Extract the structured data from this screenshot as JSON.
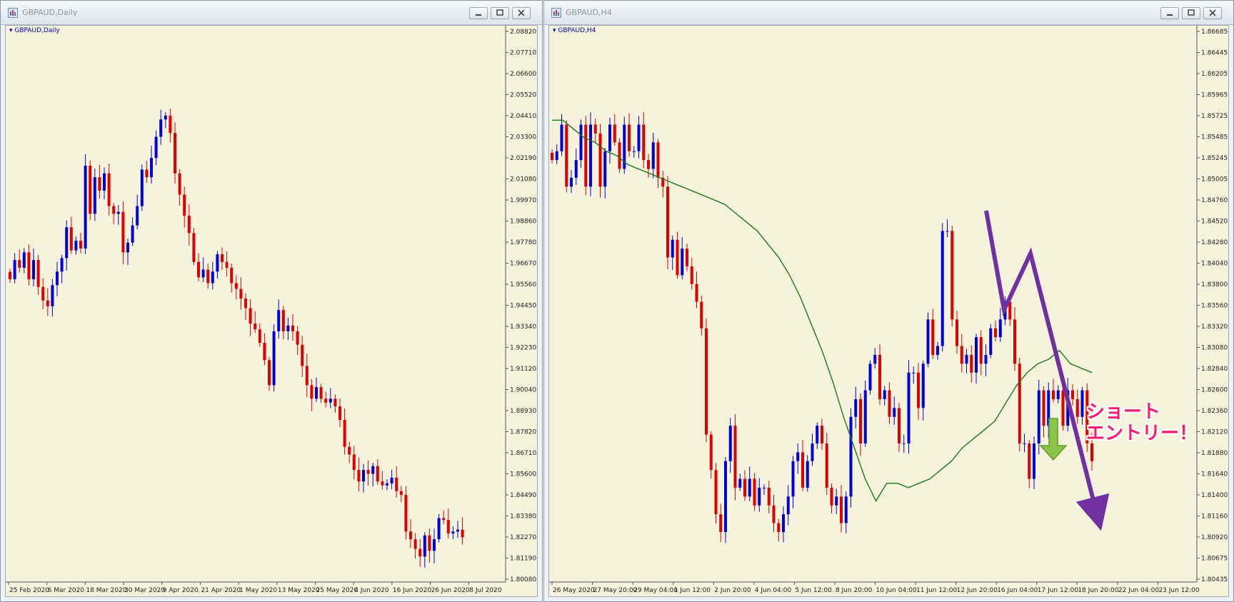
{
  "windows": [
    {
      "title": "GBPAUD,Daily",
      "symbol_label": "GBPAUD,Daily",
      "controls": [
        "minimize-icon",
        "restore-icon",
        "close-icon"
      ],
      "chart_data": {
        "type": "candlestick",
        "symbol": "GBPAUD",
        "timeframe": "Daily",
        "price_ticks": [
          "2.08820",
          "2.07710",
          "2.06600",
          "2.05520",
          "2.04410",
          "2.03300",
          "2.02190",
          "2.01080",
          "1.99970",
          "1.98860",
          "1.97780",
          "1.96670",
          "1.95560",
          "1.94450",
          "1.93340",
          "1.92230",
          "1.91120",
          "1.90040",
          "1.88930",
          "1.87820",
          "1.86710",
          "1.85600",
          "1.84490",
          "1.83380",
          "1.82270",
          "1.81190",
          "1.80080"
        ],
        "ylim": [
          1.8008,
          2.0882
        ],
        "time_ticks": [
          "25 Feb 2020",
          "6 Mar 2020",
          "18 Mar 2020",
          "30 Mar 2020",
          "9 Apr 2020",
          "21 Apr 2020",
          "1 May 2020",
          "13 May 2020",
          "25 May 2020",
          "4 Jun 2020",
          "16 Jun 2020",
          "26 Jun 2020",
          "8 Jul 2020"
        ],
        "up_color": "#0000dd",
        "down_color": "#e00000",
        "grid": false,
        "close": [
          1.958,
          1.968,
          1.964,
          1.972,
          1.958,
          1.968,
          1.954,
          1.947,
          1.944,
          1.955,
          1.962,
          1.969,
          1.985,
          1.973,
          1.978,
          1.974,
          2.017,
          1.992,
          2.011,
          2.004,
          2.013,
          1.996,
          1.992,
          1.993,
          1.972,
          1.977,
          1.986,
          1.996,
          2.015,
          2.011,
          2.021,
          2.032,
          2.041,
          2.043,
          2.034,
          2.013,
          2.002,
          1.991,
          1.982,
          1.967,
          1.959,
          1.963,
          1.956,
          1.962,
          1.971,
          1.967,
          1.964,
          1.956,
          1.953,
          1.948,
          1.943,
          1.935,
          1.932,
          1.925,
          1.916,
          1.903,
          1.931,
          1.942,
          1.931,
          1.934,
          1.931,
          1.924,
          1.913,
          1.903,
          1.896,
          1.902,
          1.896,
          1.894,
          1.896,
          1.892,
          1.885,
          1.871,
          1.867,
          1.859,
          1.853,
          1.859,
          1.857,
          1.861,
          1.853,
          1.851,
          1.852,
          1.855,
          1.848,
          1.846,
          1.827,
          1.823,
          1.818,
          1.814,
          1.825,
          1.817,
          1.823,
          1.834,
          1.833,
          1.826,
          1.827,
          1.828,
          1.824
        ]
      }
    },
    {
      "title": "GBPAUD,H4",
      "symbol_label": "GBPAUD,H4",
      "controls": [
        "minimize-icon",
        "restore-icon",
        "close-icon"
      ],
      "chart_data": {
        "type": "candlestick",
        "symbol": "GBPAUD",
        "timeframe": "H4",
        "price_ticks": [
          "1.86685",
          "1.86445",
          "1.86205",
          "1.85965",
          "1.85725",
          "1.85485",
          "1.85245",
          "1.85005",
          "1.84760",
          "1.84520",
          "1.84280",
          "1.84040",
          "1.83800",
          "1.83560",
          "1.83320",
          "1.83080",
          "1.82840",
          "1.82600",
          "1.82360",
          "1.82120",
          "1.81880",
          "1.81640",
          "1.81400",
          "1.81160",
          "1.80920",
          "1.80675",
          "1.80435"
        ],
        "ylim": [
          1.80435,
          1.86685
        ],
        "time_ticks": [
          "26 May 2020",
          "27 May 20:00",
          "29 May 04:00",
          "1 Jun 12:00",
          "2 Jun 20:00",
          "4 Jun 04:00",
          "5 Jun 12:00",
          "8 Jun 20:00",
          "10 Jun 04:00",
          "11 Jun 12:00",
          "12 Jun 20:00",
          "16 Jun 04:00",
          "17 Jun 12:00",
          "18 Jun 20:00",
          "22 Jun 04:00",
          "23 Jun 12:00"
        ],
        "up_color": "#0000dd",
        "down_color": "#e00000",
        "ma_color": "#1a7a1a",
        "arrow_color": "#7030a0",
        "grid": false,
        "close": [
          1.852,
          1.853,
          1.856,
          1.849,
          1.85,
          1.852,
          1.856,
          1.849,
          1.856,
          1.855,
          1.849,
          1.853,
          1.856,
          1.854,
          1.851,
          1.856,
          1.853,
          1.853,
          1.856,
          1.852,
          1.851,
          1.854,
          1.85,
          1.849,
          1.841,
          1.843,
          1.839,
          1.842,
          1.84,
          1.838,
          1.836,
          1.833,
          1.821,
          1.817,
          1.812,
          1.81,
          1.818,
          1.822,
          1.815,
          1.816,
          1.814,
          1.816,
          1.813,
          1.815,
          1.815,
          1.813,
          1.811,
          1.81,
          1.812,
          1.814,
          1.818,
          1.819,
          1.815,
          1.818,
          1.82,
          1.822,
          1.82,
          1.815,
          1.813,
          1.814,
          1.811,
          1.814,
          1.823,
          1.825,
          1.82,
          1.826,
          1.829,
          1.83,
          1.825,
          1.826,
          1.823,
          1.824,
          1.82,
          1.82,
          1.828,
          1.828,
          1.824,
          1.829,
          1.834,
          1.83,
          1.831,
          1.844,
          1.844,
          1.834,
          1.831,
          1.829,
          1.83,
          1.828,
          1.832,
          1.829,
          1.83,
          1.833,
          1.832,
          1.834,
          1.836,
          1.834,
          1.829,
          1.82,
          1.82,
          1.816,
          1.82,
          1.826,
          1.822,
          1.826,
          1.825,
          1.826,
          1.822,
          1.826,
          1.825,
          1.823,
          1.826,
          1.82,
          1.818
        ],
        "ma": [
          1.8565,
          1.8565,
          1.8555,
          1.8545,
          1.854,
          1.853,
          1.8525,
          1.8515,
          1.851,
          1.8505,
          1.85,
          1.8495,
          1.849,
          1.8485,
          1.848,
          1.8475,
          1.847,
          1.846,
          1.845,
          1.844,
          1.8425,
          1.841,
          1.839,
          1.8365,
          1.8335,
          1.8305,
          1.827,
          1.823,
          1.8195,
          1.816,
          1.8135,
          1.8155,
          1.8155,
          1.815,
          1.8155,
          1.816,
          1.817,
          1.818,
          1.8195,
          1.8205,
          1.8215,
          1.8225,
          1.8245,
          1.8265,
          1.828,
          1.829,
          1.8295,
          1.8305,
          1.829,
          1.8285,
          1.828
        ]
      },
      "annotation": {
        "line1": "ショート",
        "line2": "エントリー！"
      }
    }
  ]
}
